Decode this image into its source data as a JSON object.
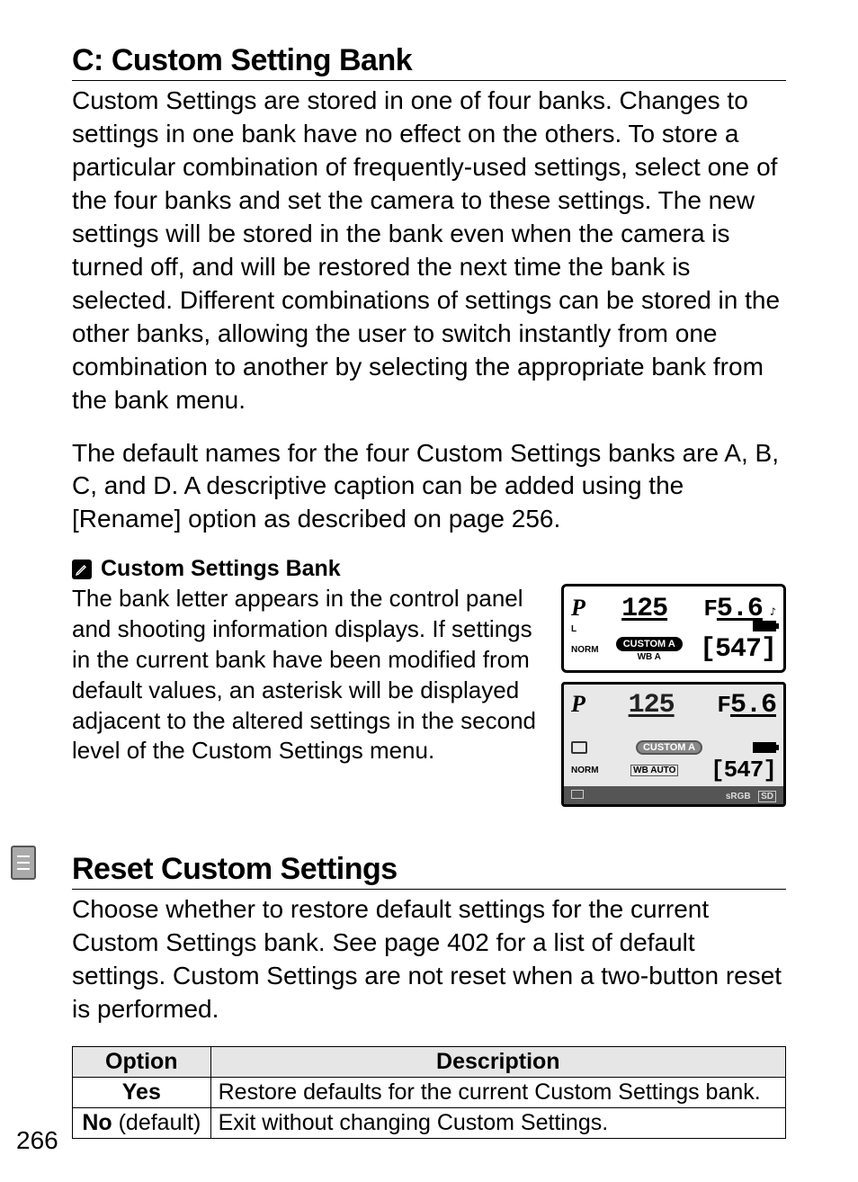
{
  "section1": {
    "heading": "C: Custom Setting Bank",
    "para1": "Custom Settings are stored in one of four banks.  Changes to settings in one bank have no effect on the others.  To store a particular combination of frequently-used settings, select one of the four banks and set the camera to these settings.  The new settings will be stored in the bank even when the camera is turned off, and will be restored the next time the bank is selected.  Different combinations of settings can be stored in the other banks, allowing the user to switch instantly from one combination to another by selecting the appropriate bank from the bank menu.",
    "para2": "The default names for the four Custom Settings banks are A, B, C, and D.  A descriptive caption can be added using the [Rename] option as described on page 256."
  },
  "note": {
    "title": "Custom Settings Bank",
    "text": "The bank letter appears in the control panel and shooting information displays. If settings in the current bank have been modified from default values, an asterisk will be displayed adjacent to the altered settings in the second level of the Custom Settings menu."
  },
  "lcd1": {
    "mode": "P",
    "quality": "L",
    "shutter": "125",
    "aperture_prefix": "F",
    "aperture": "5.6",
    "norm": "NORM",
    "custom": "CUSTOM A",
    "wb": "WB A",
    "remaining": "547"
  },
  "lcd2": {
    "mode": "P",
    "shutter": "125",
    "aperture_prefix": "F",
    "aperture": "5.6",
    "norm": "NORM",
    "custom": "CUSTOM A",
    "wb": "WB AUTO",
    "remaining": "547",
    "srgb": "sRGB",
    "sd": "SD"
  },
  "section2": {
    "heading": "Reset Custom Settings",
    "para": "Choose whether to restore default settings for the current Custom Settings bank.  See page 402 for a list of default settings.  Custom Settings are not reset when a two-button reset is performed."
  },
  "table": {
    "head_option": "Option",
    "head_desc": "Description",
    "rows": [
      {
        "opt_bold": "Yes",
        "opt_suffix": "",
        "desc": "Restore defaults for the current Custom Settings bank."
      },
      {
        "opt_bold": "No",
        "opt_suffix": " (default)",
        "desc": "Exit without changing Custom Settings."
      }
    ]
  },
  "page_number": "266"
}
